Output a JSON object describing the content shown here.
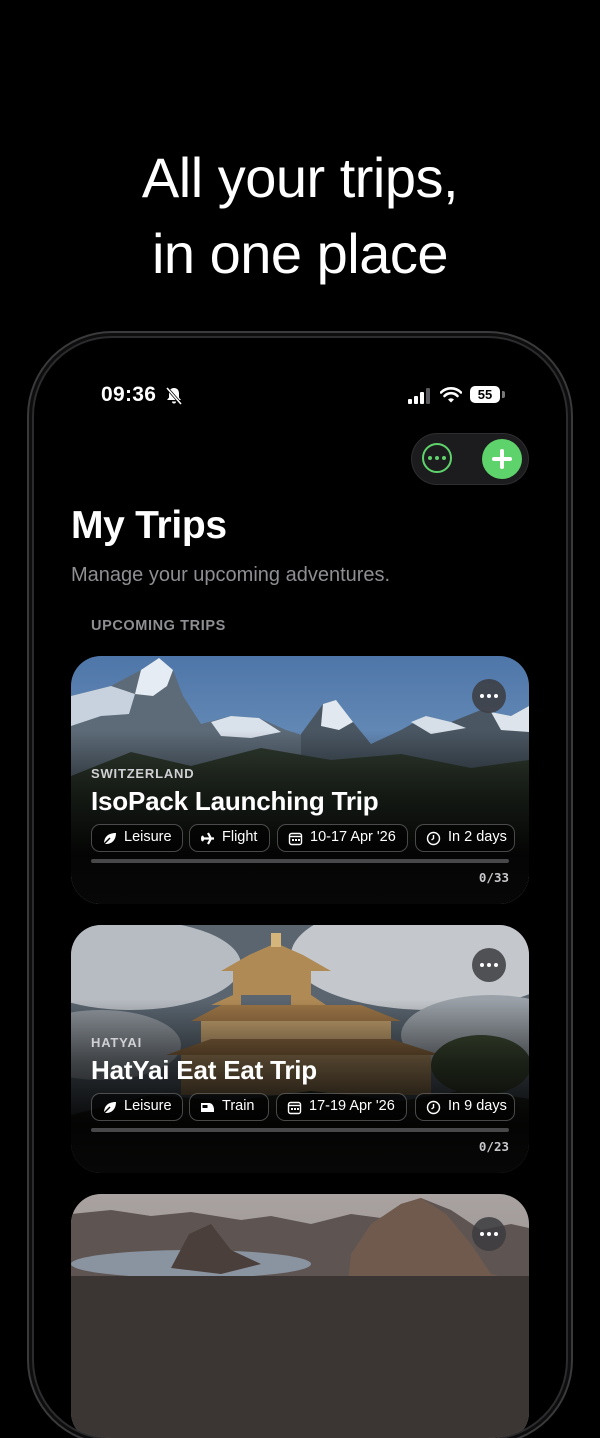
{
  "headline": {
    "line1": "All your trips,",
    "line2": "in one place"
  },
  "status_bar": {
    "time": "09:36",
    "battery": "55"
  },
  "page": {
    "title": "My Trips",
    "subtitle": "Manage your upcoming adventures.",
    "section_label": "UPCOMING TRIPS"
  },
  "trips": [
    {
      "country": "SWITZERLAND",
      "name": "IsoPack Launching Trip",
      "category": "Leisure",
      "transport": "Flight",
      "dates": "10-17 Apr '26",
      "countdown": "In 2 days",
      "progress": 0,
      "progress_label": "0/33"
    },
    {
      "country": "HATYAI",
      "name": "HatYai Eat Eat Trip",
      "category": "Leisure",
      "transport": "Train",
      "dates": "17-19 Apr '26",
      "countdown": "In 9 days",
      "progress": 0,
      "progress_label": "0/23"
    },
    {}
  ],
  "colors": {
    "accent": "#5fd36b",
    "background": "#000000",
    "muted_text": "#8e8e93"
  }
}
